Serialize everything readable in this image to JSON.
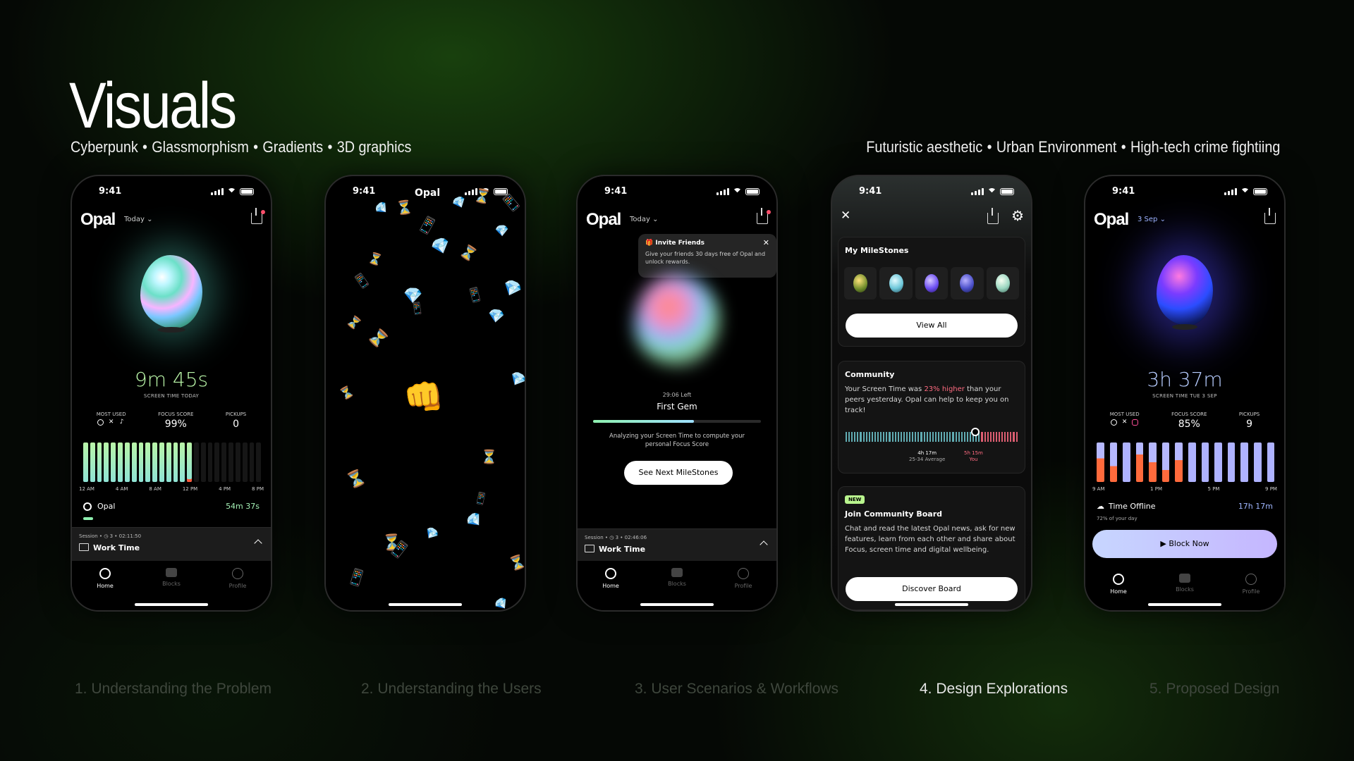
{
  "slide": {
    "title": "Visuals",
    "tags_left": [
      "Cyberpunk",
      "Glassmorphism",
      "Gradients",
      "3D graphics"
    ],
    "tags_right": [
      "Futuristic aesthetic",
      "Urban Environment",
      "High-tech crime fightiing"
    ]
  },
  "status_time": "9:41",
  "phone1": {
    "logo": "Opal",
    "date": "Today",
    "screen_time": "9m 45s",
    "screen_time_label": "SCREEN TIME TODAY",
    "most_used_label": "MOST USED",
    "focus_label": "FOCUS SCORE",
    "focus_value": "99%",
    "pickups_label": "PICKUPS",
    "pickups_value": "0",
    "axis": [
      "12 AM",
      "4 AM",
      "8 AM",
      "12 PM",
      "4 PM",
      "8 PM"
    ],
    "app_name": "Opal",
    "app_time": "54m 37s",
    "session_meta": "Session • ◷ 3 • 02:11:50",
    "session_name": "Work Time"
  },
  "tabs": {
    "home": "Home",
    "blocks": "Blocks",
    "profile": "Profile"
  },
  "phone2": {
    "logo": "Opal"
  },
  "phone3": {
    "logo": "Opal",
    "date": "Today",
    "invite_title": "Invite Friends",
    "invite_text": "Give your friends 30 days free of Opal and unlock rewards.",
    "time_left": "29:06 Left",
    "gem_name": "First Gem",
    "progress": 0.6,
    "analyzing": "Analyzing your Screen Time to compute your personal Focus Score",
    "next_btn": "See Next MileStones",
    "session_meta": "Session • ◷ 3 • 02:46:06",
    "session_name": "Work Time"
  },
  "phone4": {
    "milestones_title": "My MileStones",
    "view_all": "View All",
    "community_title": "Community",
    "community_text_a": "Your Screen Time was ",
    "community_highlight": "23% higher",
    "community_text_b": " than your peers yesterday. Opal can help to keep you on track!",
    "avg_value": "4h 17m",
    "avg_label": "25-34 Average",
    "you_value": "5h 15m",
    "you_label": "You",
    "new_badge": "NEW",
    "board_title": "Join Community Board",
    "board_text": "Chat and read the latest Opal news, ask for new features, learn from each other and share about Focus, screen time and digital wellbeing.",
    "discover_btn": "Discover Board"
  },
  "phone5": {
    "logo": "Opal",
    "date": "3 Sep",
    "screen_time": "3h 37m",
    "screen_time_label": "SCREEN TIME TUE 3 SEP",
    "most_used_label": "MOST USED",
    "focus_label": "FOCUS SCORE",
    "focus_value": "85%",
    "pickups_label": "PICKUPS",
    "pickups_value": "9",
    "axis": [
      "9 AM",
      "1 PM",
      "5 PM",
      "9 PM"
    ],
    "offline_label": "Time Offline",
    "offline_value": "17h 17m",
    "offline_sub": "72% of your day",
    "block_btn": "Block Now"
  },
  "footer_nav": [
    "1.  Understanding the Problem",
    "2.  Understanding the Users",
    "3.  User Scenarios & Workflows",
    "4.  Design Explorations",
    "5.  Proposed Design"
  ],
  "colors": {
    "accent_green": "#8ff0b0",
    "accent_blue": "#7fb6ff",
    "highlight_red": "#ff6b81",
    "button_lavender": "#c9c5ff"
  }
}
